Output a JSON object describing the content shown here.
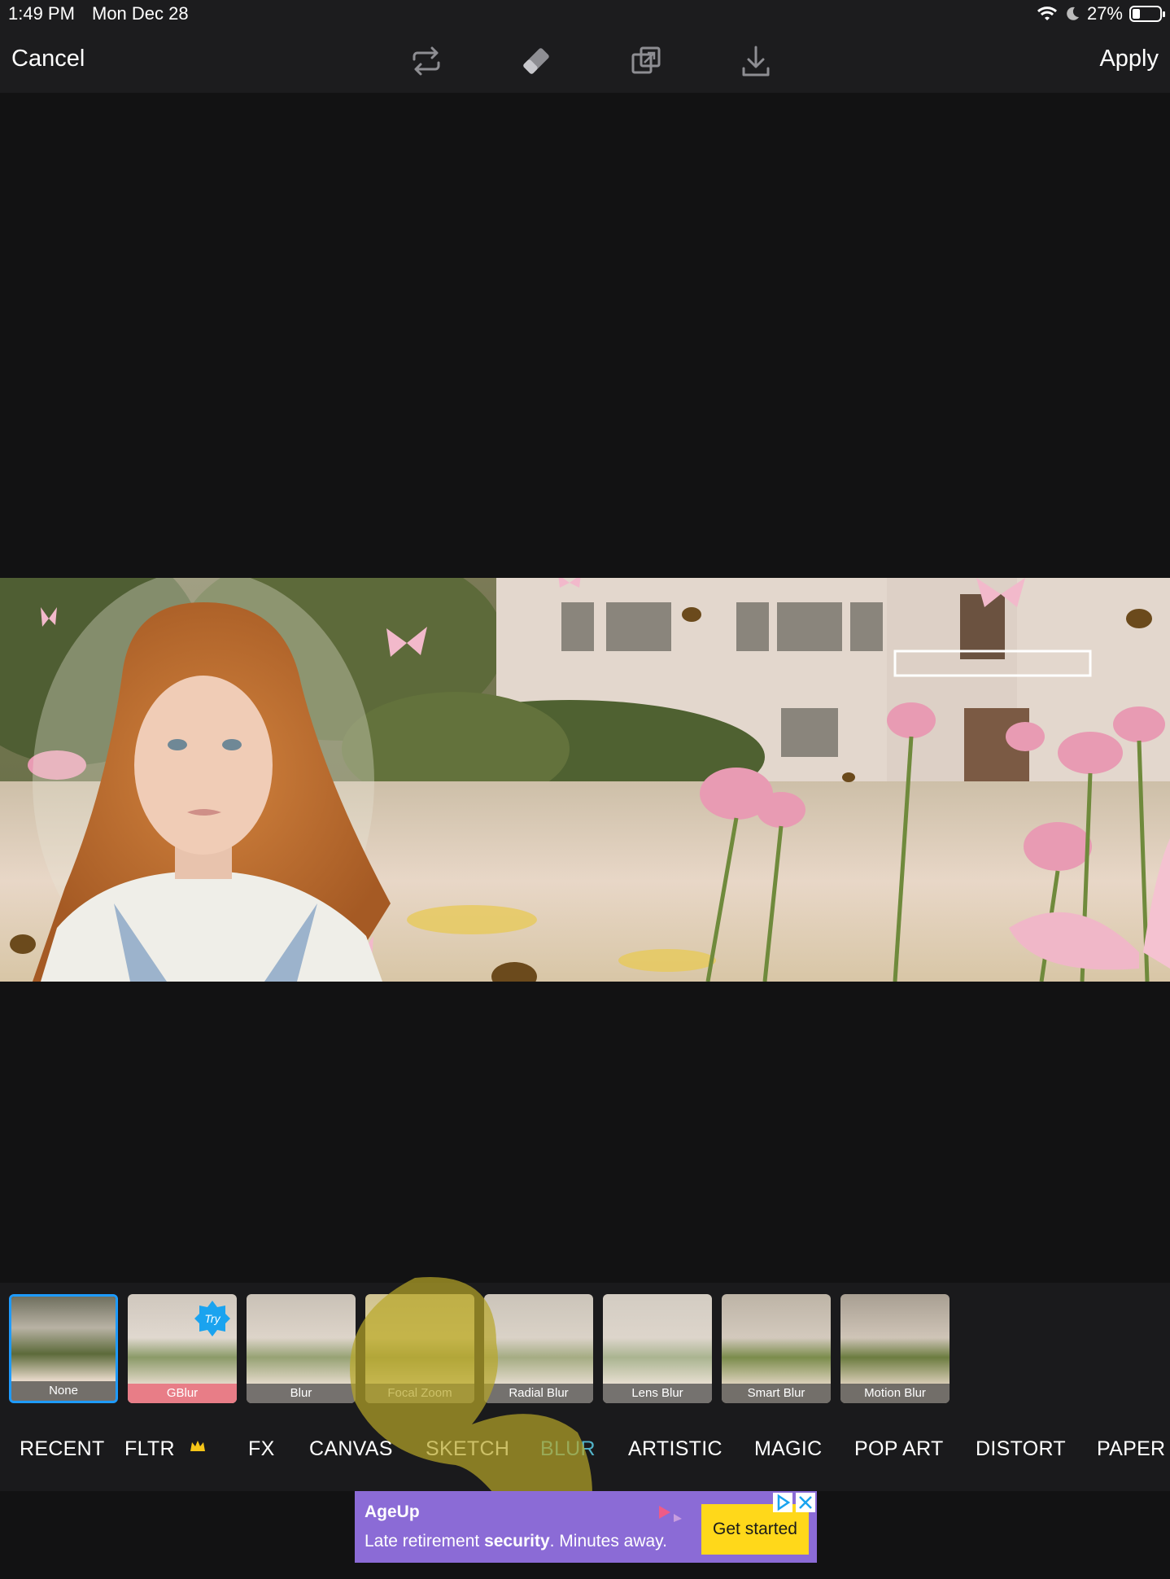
{
  "status_bar": {
    "time": "1:49 PM",
    "date": "Mon Dec 28",
    "battery_percent": "27%",
    "battery_level": 0.27,
    "icons": [
      "wifi-icon",
      "moon-icon",
      "battery-icon"
    ]
  },
  "toolbar": {
    "cancel_label": "Cancel",
    "apply_label": "Apply",
    "icons": [
      "swap-icon",
      "eraser-icon",
      "compare-icon",
      "download-icon"
    ]
  },
  "effects": {
    "selected": "None",
    "items": [
      {
        "label": "None"
      },
      {
        "label": "GBlur",
        "badge": "Try"
      },
      {
        "label": "Blur"
      },
      {
        "label": "Focal Zoom"
      },
      {
        "label": "Radial Blur"
      },
      {
        "label": "Lens Blur"
      },
      {
        "label": "Smart Blur"
      },
      {
        "label": "Motion Blur"
      }
    ]
  },
  "categories": {
    "active": "BLUR",
    "items": [
      "RECENT",
      "FLTR",
      "FX",
      "CANVAS",
      "SKETCH",
      "BLUR",
      "ARTISTIC",
      "MAGIC",
      "POP ART",
      "DISTORT",
      "PAPER"
    ]
  },
  "ad": {
    "brand": "AgeUp",
    "tagline_pre": "Late retirement ",
    "tagline_bold": "security",
    "tagline_post": ". Minutes away.",
    "cta": "Get started",
    "colors": {
      "background": "#8b6bd6",
      "cta": "#ffd81a"
    }
  },
  "colors": {
    "accent_selected": "#1e9bff",
    "active_category": "#52b4c9",
    "gblur_label": "#e87d87"
  }
}
